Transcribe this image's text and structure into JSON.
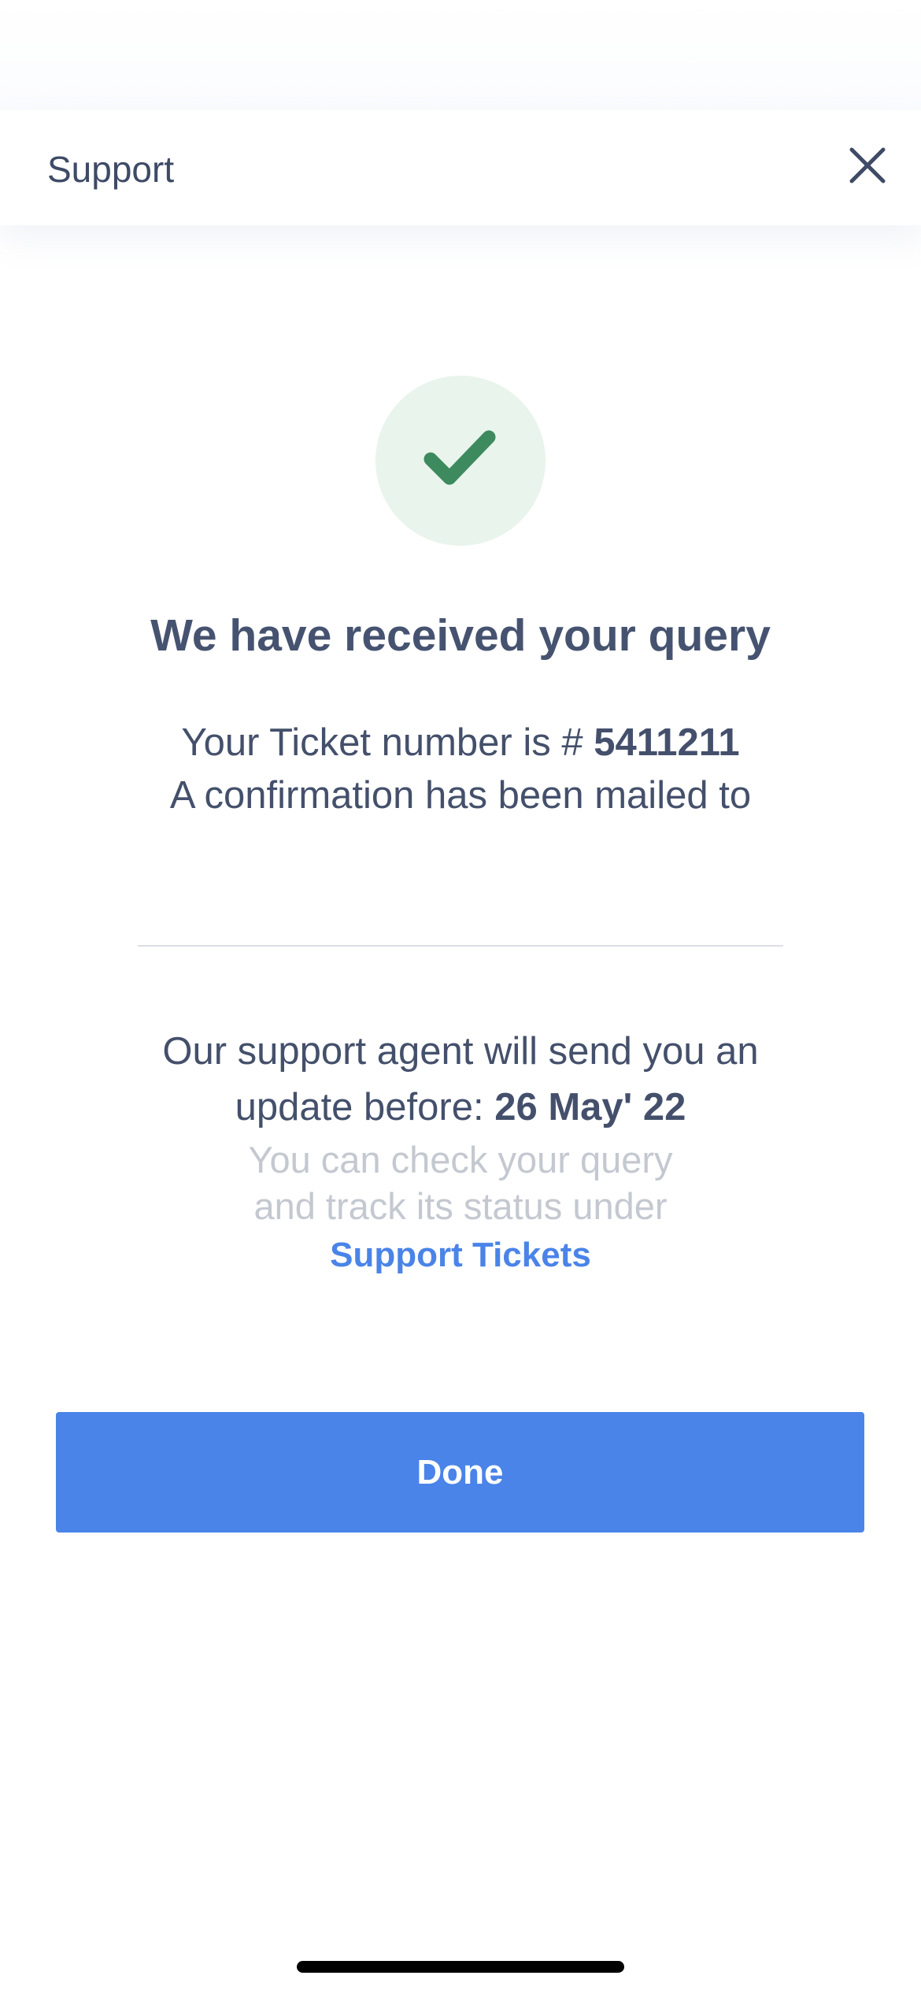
{
  "header": {
    "title": "Support",
    "close_icon": "close-icon"
  },
  "status": {
    "icon": "checkmark-icon",
    "icon_color": "#3d8a5e",
    "circle_color": "#e9f4ec"
  },
  "confirmation": {
    "headline": "We have received your query",
    "ticket_prefix": "Your Ticket number is # ",
    "ticket_number": "5411211",
    "mailed_text": "A confirmation has been mailed to"
  },
  "update": {
    "line1": "Our support agent will send you an",
    "line2_prefix": "update before: ",
    "date": "26 May' 22",
    "check_line1": "You can check your query",
    "check_line2": "and track its status under",
    "link_label": "Support Tickets"
  },
  "actions": {
    "done_label": "Done"
  },
  "colors": {
    "accent": "#4a84e8",
    "text": "#44506b",
    "muted": "#c4c8d0"
  }
}
